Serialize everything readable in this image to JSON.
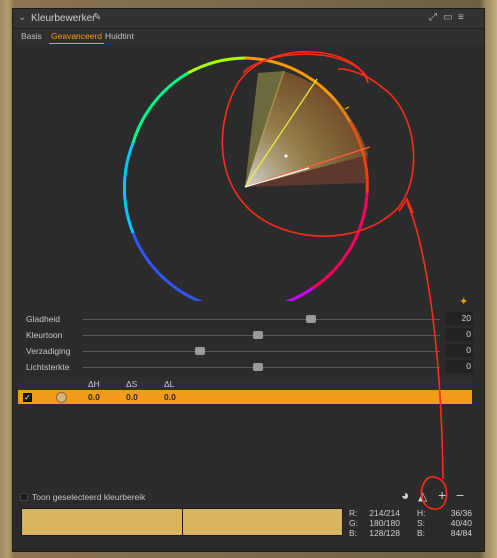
{
  "panel": {
    "title": "Kleurbewerker",
    "tabs": [
      "Basis",
      "Geavanceerd",
      "Huidtint"
    ],
    "active_tab": "Geavanceerd"
  },
  "sliders": [
    {
      "label": "Gladheid",
      "value": "20",
      "level": 0.68
    },
    {
      "label": "Kleurtoon",
      "value": "0",
      "level": 0.5
    },
    {
      "label": "Verzadiging",
      "value": "0",
      "level": 0.36
    },
    {
      "label": "Lichtsterkte",
      "value": "0",
      "level": 0.5
    }
  ],
  "table": {
    "headers": [
      "ΔH",
      "ΔS",
      "ΔL"
    ],
    "rows": [
      {
        "checked": true,
        "dh": "0.0",
        "ds": "0.0",
        "dl": "0.0"
      }
    ]
  },
  "bottom": {
    "show_selected_label": "Toon geselecteerd kleurbereik"
  },
  "readout": {
    "rgb": [
      [
        "R:",
        "214/214"
      ],
      [
        "G:",
        "180/180"
      ],
      [
        "B:",
        "128/128"
      ]
    ],
    "hsb": [
      [
        "H:",
        "36/36"
      ],
      [
        "S:",
        "40/40"
      ],
      [
        "B:",
        "84/84"
      ]
    ]
  },
  "colors": {
    "accent": "#f39c1b",
    "selected_color": "#d9b55f",
    "annotation": "#ff2a1a"
  },
  "icons": [
    "collapse-chevron-icon",
    "color-picker-icon",
    "pin-icon",
    "dock-icon",
    "menu-icon",
    "wand-icon",
    "color-wheel-icon",
    "picker-tool-icon",
    "add-icon",
    "remove-icon"
  ]
}
